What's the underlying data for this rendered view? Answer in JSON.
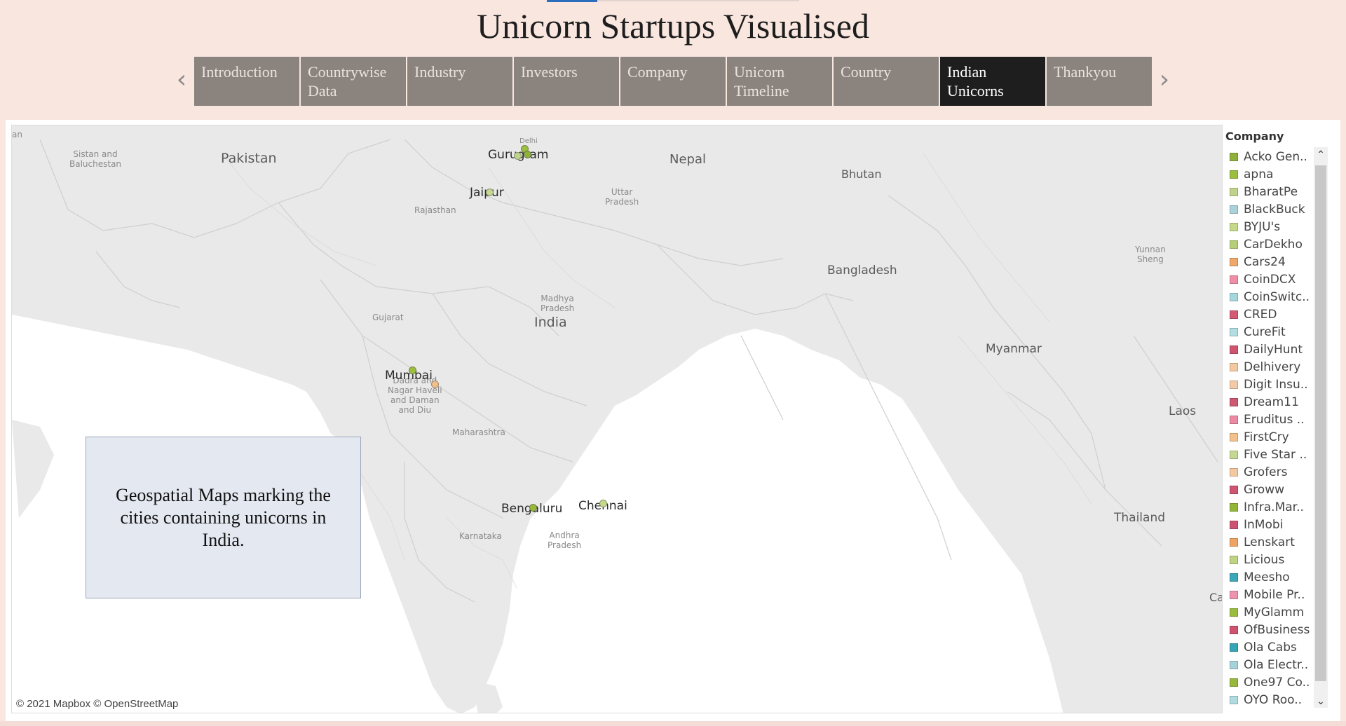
{
  "page": {
    "title": "Unicorn Startups Visualised"
  },
  "nav": {
    "prev_icon": "chevron-left-icon",
    "next_icon": "chevron-right-icon",
    "tabs": [
      {
        "label": "Introduction",
        "active": false
      },
      {
        "label": "Countrywise Data",
        "active": false
      },
      {
        "label": "Industry",
        "active": false
      },
      {
        "label": "Investors",
        "active": false
      },
      {
        "label": "Company",
        "active": false
      },
      {
        "label": "Unicorn Timeline",
        "active": false
      },
      {
        "label": "Country",
        "active": false
      },
      {
        "label": "Indian Unicorns",
        "active": true
      },
      {
        "label": "Thankyou",
        "active": false
      }
    ]
  },
  "map": {
    "attribution": "© 2021 Mapbox © OpenStreetMap",
    "labels": {
      "an": "an",
      "sistan": "Sistan and\nBaluchestan",
      "pakistan": "Pakistan",
      "nepal": "Nepal",
      "bhutan": "Bhutan",
      "bangladesh": "Bangladesh",
      "myanmar": "Myanmar",
      "laos": "Laos",
      "thailand": "Thailand",
      "india": "India",
      "yunnan": "Yunnan\nSheng",
      "uttar": "Uttar\nPradesh",
      "rajasthan": "Rajasthan",
      "madhya": "Madhya\nPradesh",
      "gujarat": "Gujarat",
      "dadra": "Dadra and\nNagar Haveli\nand Daman\nand Diu",
      "maharashtra": "Maharashtra",
      "karnataka": "Karnataka",
      "andhra": "Andhra\nPradesh",
      "can": "Can"
    },
    "cities": {
      "delhi": "Delhi",
      "gurugram": "Gurugram",
      "jaipur": "Jaipur",
      "mumbai": "Mumbai",
      "bengaluru": "Bengaluru",
      "chennai": "Chennai"
    }
  },
  "note": {
    "text": "Geospatial Maps marking the cities containing unicorns in India."
  },
  "legend": {
    "title": "Company",
    "items": [
      {
        "label": "Acko Gen..",
        "color": "#8fb03a"
      },
      {
        "label": "apna",
        "color": "#9cbf3f"
      },
      {
        "label": "BharatPe",
        "color": "#bfd48a"
      },
      {
        "label": "BlackBuck",
        "color": "#a9d3d9"
      },
      {
        "label": "BYJU's",
        "color": "#c6d98a"
      },
      {
        "label": "CarDekho",
        "color": "#b6cf76"
      },
      {
        "label": "Cars24",
        "color": "#f0a868"
      },
      {
        "label": "CoinDCX",
        "color": "#ef8fa6"
      },
      {
        "label": "CoinSwitc..",
        "color": "#a7d6dc"
      },
      {
        "label": "CRED",
        "color": "#d45a74"
      },
      {
        "label": "CureFit",
        "color": "#b2dde2"
      },
      {
        "label": "DailyHunt",
        "color": "#d0546e"
      },
      {
        "label": "Delhivery",
        "color": "#f4c9a2"
      },
      {
        "label": "Digit Insu..",
        "color": "#f3caa6"
      },
      {
        "label": "Dream11",
        "color": "#cd5870"
      },
      {
        "label": "Eruditus ..",
        "color": "#ec8aa3"
      },
      {
        "label": "FirstCry",
        "color": "#f3c28c"
      },
      {
        "label": "Five Star ..",
        "color": "#c5d892"
      },
      {
        "label": "Grofers",
        "color": "#f4c9a0"
      },
      {
        "label": "Groww",
        "color": "#cf5570"
      },
      {
        "label": "Infra.Mar..",
        "color": "#93b537"
      },
      {
        "label": "InMobi",
        "color": "#cc5471"
      },
      {
        "label": "Lenskart",
        "color": "#f0a463"
      },
      {
        "label": "Licious",
        "color": "#bed384"
      },
      {
        "label": "Meesho",
        "color": "#3aa8b8"
      },
      {
        "label": "Mobile Pr..",
        "color": "#ed93ad"
      },
      {
        "label": "MyGlamm",
        "color": "#9bbd3d"
      },
      {
        "label": "OfBusiness",
        "color": "#d0526d"
      },
      {
        "label": "Ola Cabs",
        "color": "#36a5b5"
      },
      {
        "label": "Ola Electr..",
        "color": "#a5d1d8"
      },
      {
        "label": "One97 Co..",
        "color": "#97b83b"
      },
      {
        "label": "OYO Roo..",
        "color": "#b0dbe1"
      }
    ],
    "scroll_up_icon": "chevron-up-icon",
    "scroll_down_icon": "chevron-down-icon"
  }
}
